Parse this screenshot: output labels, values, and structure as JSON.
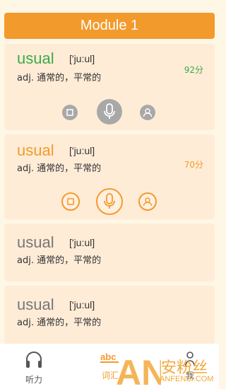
{
  "header": {
    "title": "Module 1"
  },
  "cards": [
    {
      "word": "usual",
      "phonetic": "['ju:ul]",
      "definition": "adj. 通常的，平常的",
      "score": "92分",
      "word_color": "#3caa4b",
      "score_color": "#3caa4b",
      "state": "gray"
    },
    {
      "word": "usual",
      "phonetic": "['ju:ul]",
      "definition": "adj. 通常的，平常的",
      "score": "70分",
      "word_color": "#f39a2c",
      "score_color": "#f39a2c",
      "state": "orange"
    },
    {
      "word": "usual",
      "phonetic": "['ju:ul]",
      "definition": "adj. 通常的，平常的",
      "word_color": "#777777"
    },
    {
      "word": "usual",
      "phonetic": "['ju:ul]",
      "definition": "adj. 通常的，平常的",
      "word_color": "#777777"
    }
  ],
  "bottom_nav": [
    {
      "label": "听力",
      "icon": "headphones-icon"
    },
    {
      "label": "词汇",
      "icon": "abc-icon",
      "active": true
    },
    {
      "label": "我",
      "icon": "person-icon"
    }
  ],
  "watermark": {
    "text_cn": "安粉丝",
    "text_en": "ANFENSI.COM",
    "logo": "AN"
  },
  "colors": {
    "accent": "#f39a2c",
    "green": "#3caa4b",
    "background": "#fff7e6"
  }
}
